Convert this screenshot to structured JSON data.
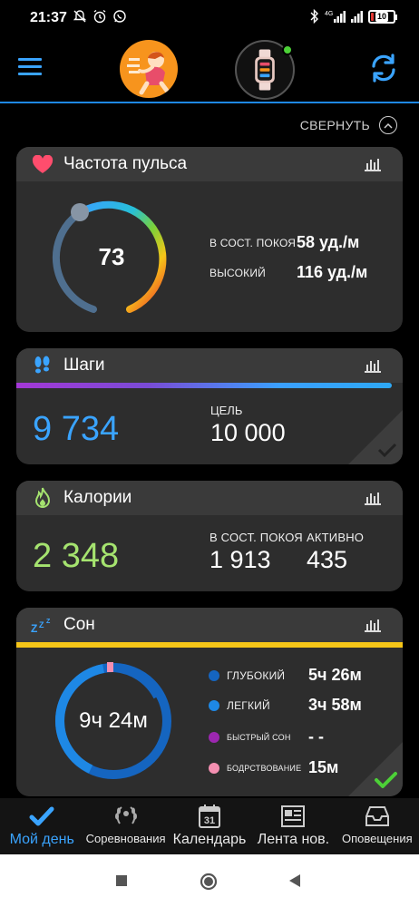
{
  "status_bar": {
    "time": "21:37",
    "network": "4G",
    "battery_level": "10",
    "battery_fraction": 0.1
  },
  "header": {
    "menu_icon": "hamburger-menu-icon",
    "avatar_icon": "runner-avatar-icon",
    "device_icon": "watch-icon",
    "sync_icon": "sync-icon",
    "colors": {
      "accent": "#3aa4ff",
      "avatar_bg": "#f7941d",
      "connected": "#4cd137"
    }
  },
  "collapse": {
    "label": "СВЕРНУТЬ"
  },
  "heart_rate": {
    "title": "Частота пульса",
    "current": "73",
    "resting_label": "В СОСТ. ПОКОЯ",
    "resting_value": "58 уд./м",
    "high_label": "ВЫСОКИЙ",
    "high_value": "116 уд./м",
    "colors": {
      "icon": "#ff4d6d"
    }
  },
  "steps": {
    "title": "Шаги",
    "value": "9 734",
    "goal_label": "ЦЕЛЬ",
    "goal_value": "10 000",
    "progress": 0.9734,
    "colors": {
      "value": "#3aa4ff",
      "icon": "#3aa4ff"
    }
  },
  "calories": {
    "title": "Калории",
    "total": "2 348",
    "resting_label": "В СОСТ. ПОКОЯ",
    "resting_value": "1 913",
    "active_label": "АКТИВНО",
    "active_value": "435",
    "colors": {
      "value": "#a5e36f"
    }
  },
  "sleep": {
    "title": "Сон",
    "total": "9ч 24м",
    "rows": [
      {
        "label": "ГЛУБОКИЙ",
        "value": "5ч 26м",
        "color": "#1565c0"
      },
      {
        "label": "ЛЕГКИЙ",
        "value": "3ч 58м",
        "color": "#1e88e5"
      },
      {
        "label": "БЫСТРЫЙ СОН",
        "value": "- -",
        "color": "#9c27b0"
      },
      {
        "label": "БОДРСТВОВАНИЕ",
        "value": "15м",
        "color": "#f48fb1"
      }
    ],
    "colors": {
      "bar": "#f5c518"
    }
  },
  "bottom_nav": [
    {
      "label": "Мой день",
      "icon": "checkmark-icon",
      "active": true
    },
    {
      "label": "Соревнования",
      "icon": "laurel-icon",
      "active": false
    },
    {
      "label": "Календарь",
      "icon": "calendar-icon",
      "active": false,
      "day": "31"
    },
    {
      "label": "Лента нов.",
      "icon": "newsfeed-icon",
      "active": false
    },
    {
      "label": "Оповещения",
      "icon": "inbox-icon",
      "active": false
    }
  ]
}
